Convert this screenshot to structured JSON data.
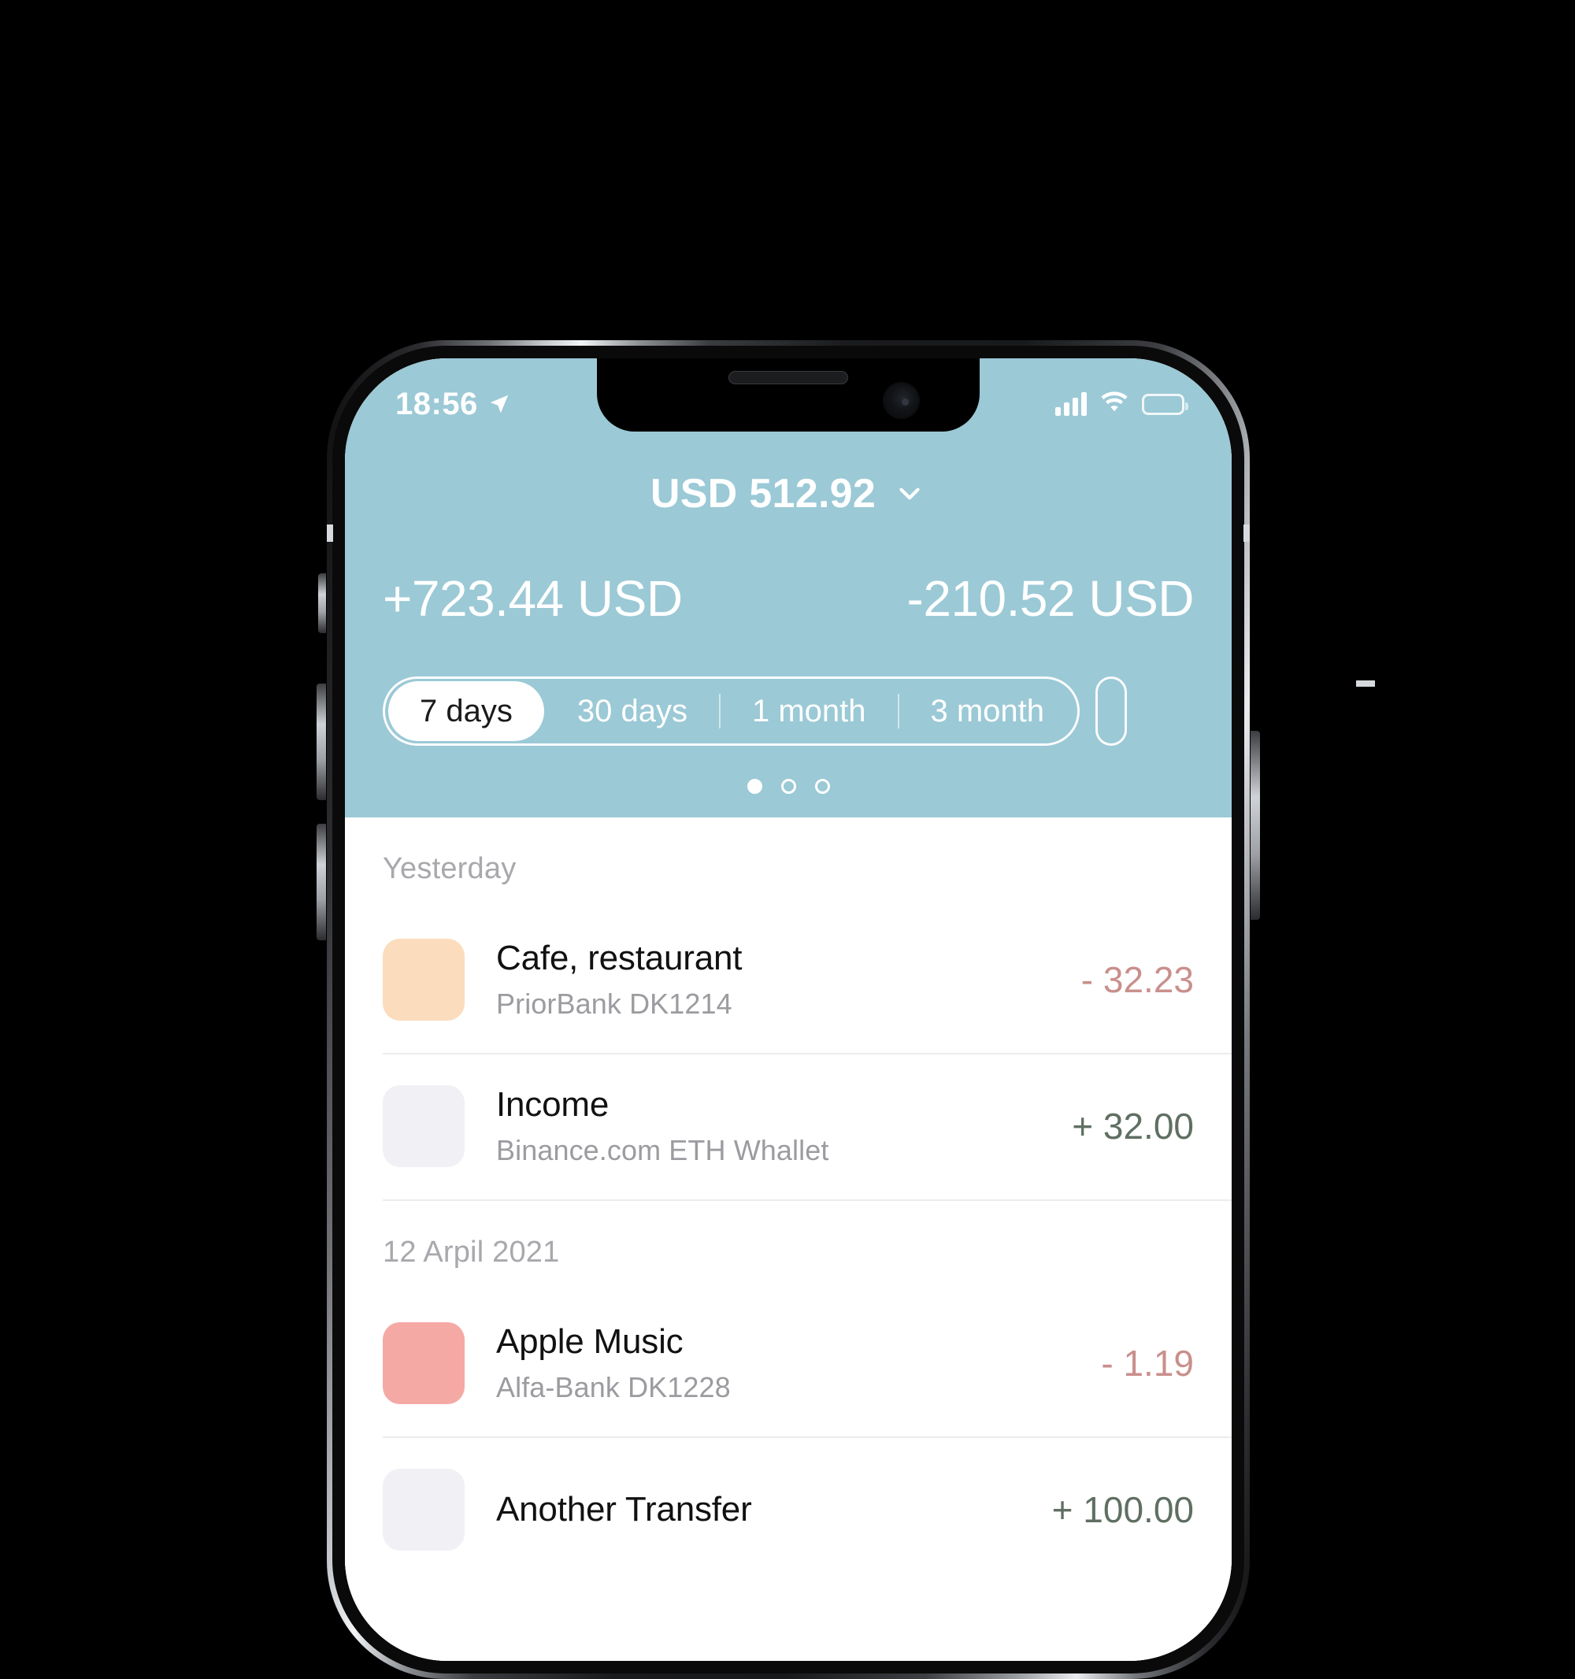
{
  "status_bar": {
    "time": "18:56",
    "location_icon": "location-arrow-icon",
    "signal_icon": "cellular-signal-icon",
    "wifi_icon": "wifi-icon",
    "battery_icon": "battery-full-icon"
  },
  "header": {
    "balance": "USD 512.92",
    "balance_chevron": "chevron-down-icon",
    "income_total": "+723.44 USD",
    "expense_total": "-210.52 USD",
    "accent_color": "#9bc9d6",
    "periods": [
      {
        "label": "7 days",
        "active": true
      },
      {
        "label": "30 days",
        "active": false
      },
      {
        "label": "1 month",
        "active": false
      },
      {
        "label": "3 month",
        "active": false
      }
    ],
    "page_dots": {
      "count": 3,
      "active_index": 0
    }
  },
  "transactions": {
    "groups": [
      {
        "date_label": "Yesterday",
        "items": [
          {
            "title": "Cafe, restaurant",
            "subtitle": "PriorBank DK1214",
            "amount": "- 32.23",
            "sign": "neg",
            "icon_color": "#fbdcbc"
          },
          {
            "title": "Income",
            "subtitle": "Binance.com ETH Whallet",
            "amount": "+ 32.00",
            "sign": "pos",
            "icon_color": "#f1f0f5"
          }
        ]
      },
      {
        "date_label": "12 Arpil 2021",
        "items": [
          {
            "title": "Apple Music",
            "subtitle": "Alfa-Bank DK1228",
            "amount": "- 1.19",
            "sign": "neg",
            "icon_color": "#f5a9a5"
          },
          {
            "title": "Another Transfer",
            "subtitle": "",
            "amount": "+ 100.00",
            "sign": "pos",
            "icon_color": "#f1f0f5"
          }
        ]
      }
    ]
  }
}
